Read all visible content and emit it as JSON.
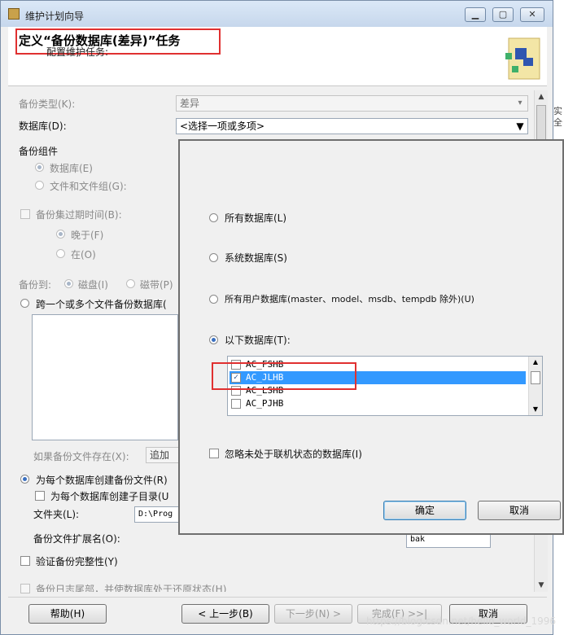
{
  "window": {
    "title": "维护计划向导",
    "header_title": "定义“备份数据库(差异)”任务",
    "header_subtitle": "配置维护任务:"
  },
  "form": {
    "backup_type_label": "备份类型(K):",
    "backup_type_value": "差异",
    "database_label": "数据库(D):",
    "database_value": "<选择一项或多项>",
    "backup_component_label": "备份组件",
    "component_database": "数据库(E)",
    "component_files": "文件和文件组(G):",
    "expire_label": "备份集过期时间(B):",
    "expire_after": "晚于(F)",
    "expire_on": "在(O)",
    "backup_to_label": "备份到:",
    "backup_to_disk": "磁盘(I)",
    "backup_to_tape": "磁带(P)",
    "span_files": "跨一个或多个文件备份数据库(",
    "if_exists_label": "如果备份文件存在(X):",
    "if_exists_value": "追加",
    "per_db_file": "为每个数据库创建备份文件(R)",
    "per_db_subdir": "为每个数据库创建子目录(U",
    "folder_label": "文件夹(L):",
    "folder_value": "D:\\Prog",
    "ext_label": "备份文件扩展名(O):",
    "ext_value": "bak",
    "verify": "验证备份完整性(Y)",
    "tail_log": "备份日志尾部，并使数据库处于还原状态(H)"
  },
  "popup": {
    "all_db": "所有数据库(L)",
    "system_db": "系统数据库(S)",
    "user_db": "所有用户数据库(master、model、msdb、tempdb 除外)(U)",
    "these_db": "以下数据库(T):",
    "databases": [
      {
        "name": "AC_FSHB",
        "checked": false,
        "selected": false
      },
      {
        "name": "AC_JLHB",
        "checked": true,
        "selected": true
      },
      {
        "name": "AC_LSHB",
        "checked": false,
        "selected": false
      },
      {
        "name": "AC_PJHB",
        "checked": false,
        "selected": false
      }
    ],
    "ignore_offline": "忽略未处于联机状态的数据库(I)",
    "ok": "确定",
    "cancel": "取消"
  },
  "footer": {
    "help": "帮助(H)",
    "back": "< 上一步(B)",
    "next": "下一步(N) >",
    "finish": "完成(F) >>|",
    "cancel": "取消"
  },
  "watermark": "https://blog.csdn.net/hello_world_1996",
  "right_sliver_text": "实 全",
  "colors": {
    "highlight": "#3399ff",
    "annotation": "#e03030"
  }
}
